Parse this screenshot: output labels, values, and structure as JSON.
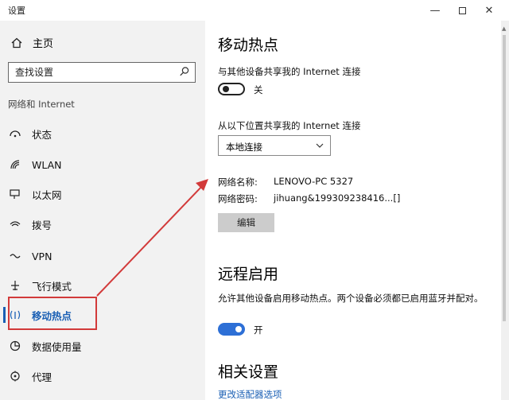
{
  "window": {
    "title": "设置",
    "minimize": "—",
    "close": "✕"
  },
  "sidebar": {
    "home_label": "主页",
    "search_placeholder": "查找设置",
    "section_label": "网络和 Internet",
    "items": [
      {
        "label": "状态",
        "icon": "status-icon"
      },
      {
        "label": "WLAN",
        "icon": "wifi-icon"
      },
      {
        "label": "以太网",
        "icon": "ethernet-icon"
      },
      {
        "label": "拨号",
        "icon": "dialup-icon"
      },
      {
        "label": "VPN",
        "icon": "vpn-icon"
      },
      {
        "label": "飞行模式",
        "icon": "airplane-icon"
      },
      {
        "label": "移动热点",
        "icon": "hotspot-icon",
        "active": true
      },
      {
        "label": "数据使用量",
        "icon": "data-usage-icon"
      },
      {
        "label": "代理",
        "icon": "proxy-icon"
      }
    ]
  },
  "main": {
    "title": "移动热点",
    "share_label": "与其他设备共享我的 Internet 连接",
    "share_toggle_state": "关",
    "share_from_label": "从以下位置共享我的 Internet 连接",
    "share_from_value": "本地连接",
    "network_name_label": "网络名称:",
    "network_name_value": "LENOVO-PC 5327",
    "network_password_label": "网络密码:",
    "network_password_value": "jihuang&199309238416...[]",
    "edit_button": "编辑",
    "remote_title": "远程启用",
    "remote_desc": "允许其他设备启用移动热点。两个设备必须都已启用蓝牙并配对。",
    "remote_toggle_state": "开",
    "related_title": "相关设置",
    "related_link": "更改适配器选项"
  },
  "colors": {
    "accent": "#1a5fb4",
    "toggle_on": "#2d6fd6",
    "annotation_red": "#d23a3a"
  }
}
